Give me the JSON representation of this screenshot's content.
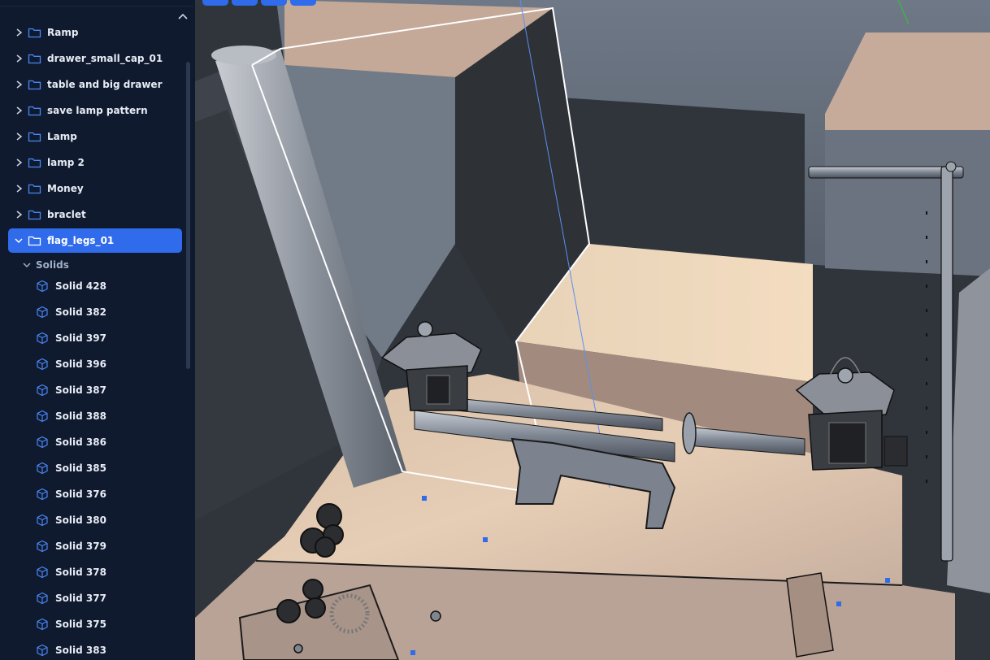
{
  "colors": {
    "sidebar_bg": "#0f1a2e",
    "accent": "#2f6bea",
    "icon_blue": "#4a86f5",
    "sub_text": "#9fb0c8",
    "viewport_bg": "#2a2d33"
  },
  "outline": {
    "collapse_icon": "chevron-up-icon",
    "folders": [
      {
        "label": "Ramp",
        "expanded": false
      },
      {
        "label": "drawer_small_cap_01",
        "expanded": false
      },
      {
        "label": "table and big drawer",
        "expanded": false
      },
      {
        "label": "save lamp pattern",
        "expanded": false
      },
      {
        "label": "Lamp",
        "expanded": false
      },
      {
        "label": "lamp 2",
        "expanded": false
      },
      {
        "label": "Money",
        "expanded": false
      },
      {
        "label": "braclet",
        "expanded": false
      },
      {
        "label": "flag_legs_01",
        "expanded": true,
        "selected": true
      }
    ],
    "group_label": "Solids",
    "solids": [
      "Solid 428",
      "Solid 382",
      "Solid 397",
      "Solid 396",
      "Solid 387",
      "Solid 388",
      "Solid 386",
      "Solid 385",
      "Solid 376",
      "Solid 380",
      "Solid 379",
      "Solid 378",
      "Solid 377",
      "Solid 375",
      "Solid 383"
    ]
  },
  "viewport": {
    "toolbar_buttons": [
      "view-button-1",
      "view-button-2",
      "view-button-3",
      "view-button-4"
    ]
  }
}
